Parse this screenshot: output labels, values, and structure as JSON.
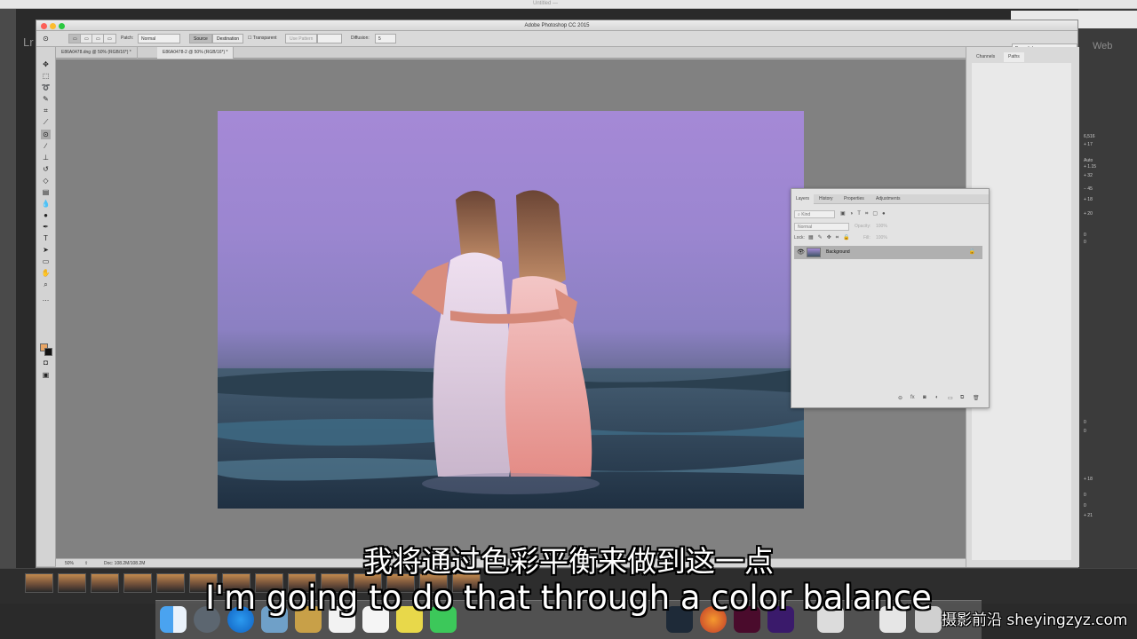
{
  "app_title": "Adobe Photoshop CC 2015",
  "background_title": "Untitled —",
  "lr_logo": "Lr",
  "lr_module": "Web",
  "doc_tabs": [
    {
      "label": "E86A0478.dng @ 50% (RGB/16*) *",
      "active": false
    },
    {
      "label": "E86A0478-2 @ 50% (RGB/16*) *",
      "active": true
    }
  ],
  "options": {
    "patch_label": "Patch:",
    "patch_value": "Normal",
    "source": "Source",
    "destination": "Destination",
    "transparent": "Transparent",
    "use_pattern": "Use Pattern",
    "diffusion_label": "Diffusion:",
    "diffusion_value": "5",
    "workspace": "Essentials"
  },
  "right_dock_tabs": [
    {
      "label": "Channels",
      "active": false
    },
    {
      "label": "Paths",
      "active": true
    }
  ],
  "layers_panel": {
    "tabs": [
      {
        "label": "Layers",
        "active": true
      },
      {
        "label": "History",
        "active": false
      },
      {
        "label": "Properties",
        "active": false
      },
      {
        "label": "Adjustments",
        "active": false
      }
    ],
    "kind_label": "Kind",
    "blend_mode": "Normal",
    "opacity_label": "Opacity:",
    "opacity_value": "100%",
    "lock_label": "Lock:",
    "fill_label": "Fill:",
    "fill_value": "100%",
    "layer_name": "Background",
    "bottom_icons": [
      "link-icon",
      "fx-icon",
      "mask-icon",
      "adjustment-icon",
      "folder-icon",
      "new-layer-icon",
      "trash-icon"
    ]
  },
  "status": {
    "zoom": "50%",
    "doc": "Doc: 108.2M/108.2M"
  },
  "lr_right_values": [
    "Auto",
    "+ 1.15",
    "+ 32",
    "− 45",
    "+ 18",
    "+ 20",
    "0",
    "0",
    "+ 17",
    "6,516",
    "0",
    "0",
    "+ 18",
    "0",
    "0",
    "+ 21"
  ],
  "subtitle_cn": "我将通过色彩平衡来做到这一点",
  "subtitle_en": "I'm going to do that through a color balance",
  "watermark": "摄影前沿 sheyingzyz.com",
  "colors": {
    "foreground_swatch": "#e8a565",
    "background_swatch": "#111111"
  }
}
